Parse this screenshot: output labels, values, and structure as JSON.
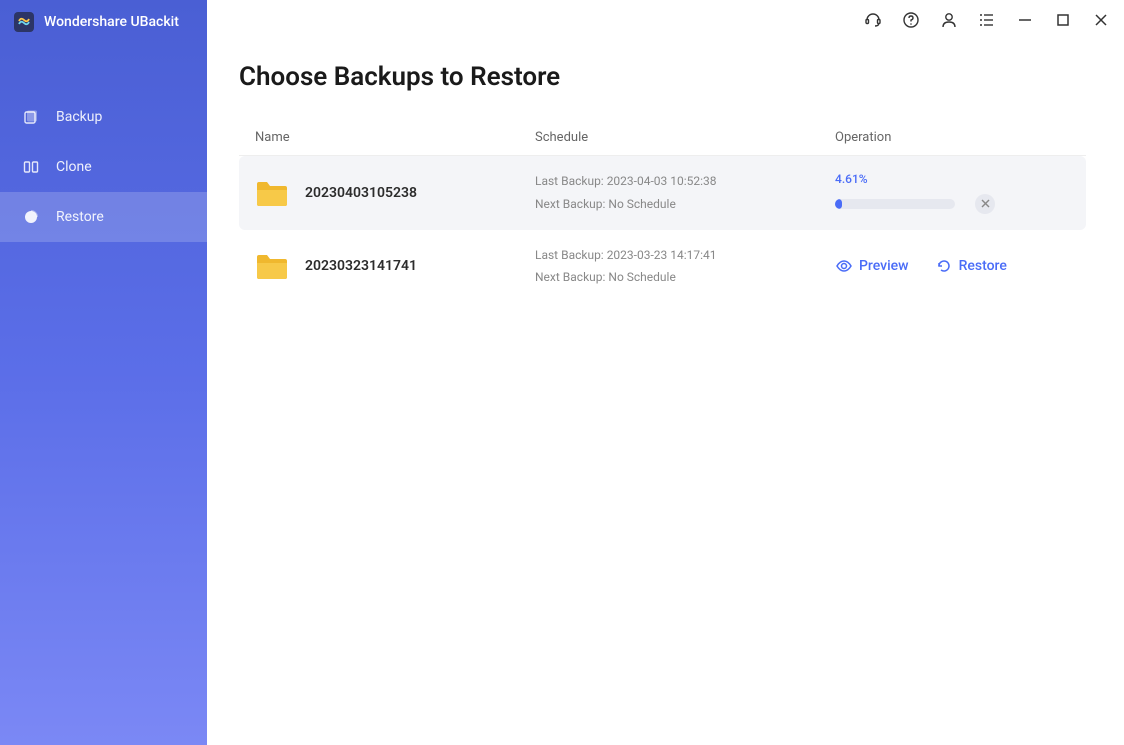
{
  "app": {
    "title": "Wondershare UBackit"
  },
  "sidebar": {
    "items": [
      {
        "label": "Backup"
      },
      {
        "label": "Clone"
      },
      {
        "label": "Restore"
      }
    ]
  },
  "page": {
    "title": "Choose Backups to Restore"
  },
  "table": {
    "headers": {
      "name": "Name",
      "schedule": "Schedule",
      "operation": "Operation"
    },
    "rows": [
      {
        "name": "20230403105238",
        "last_backup": "Last Backup: 2023-04-03 10:52:38",
        "next_backup": "Next Backup: No Schedule",
        "progress_pct": "4.61%",
        "progress_value": 4.61
      },
      {
        "name": "20230323141741",
        "last_backup": "Last Backup: 2023-03-23 14:17:41",
        "next_backup": "Next Backup: No Schedule",
        "preview_label": "Preview",
        "restore_label": "Restore"
      }
    ]
  }
}
